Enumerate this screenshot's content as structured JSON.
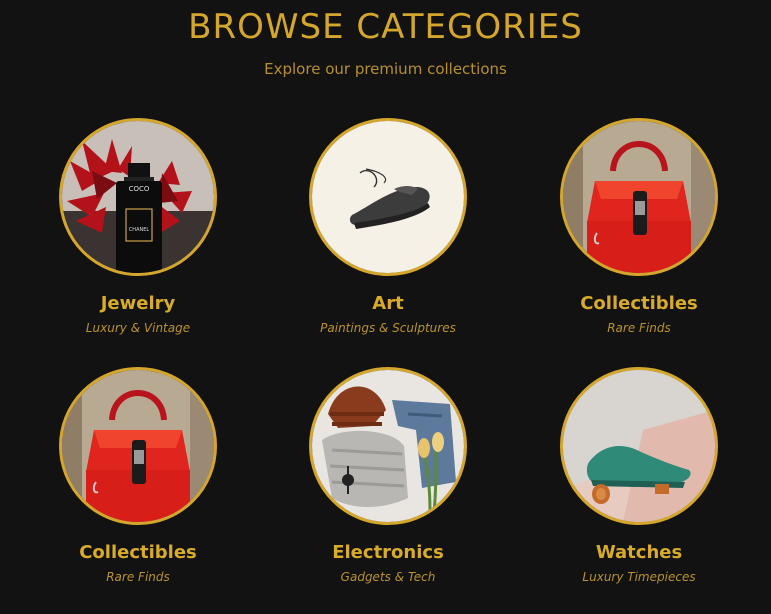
{
  "header": {
    "title": "BROWSE CATEGORIES",
    "subtitle": "Explore our premium collections"
  },
  "categories": [
    {
      "name": "Jewelry",
      "tagline": "Luxury & Vintage",
      "image": "perfume-bottle-image",
      "perfume_label_1": "COCO",
      "perfume_label_2": "CHANEL"
    },
    {
      "name": "Art",
      "tagline": "Paintings & Sculptures",
      "image": "sneaker-image"
    },
    {
      "name": "Collectibles",
      "tagline": "Rare Finds",
      "image": "red-handbag-image"
    },
    {
      "name": "Collectibles",
      "tagline": "Rare Finds",
      "image": "red-handbag-image"
    },
    {
      "name": "Electronics",
      "tagline": "Gadgets & Tech",
      "image": "clothes-flatlay-image"
    },
    {
      "name": "Watches",
      "tagline": "Luxury Timepieces",
      "image": "green-shoe-image"
    }
  ],
  "colors": {
    "background": "#131212",
    "accent": "#d4a72c",
    "subtitle": "#b58f30"
  }
}
